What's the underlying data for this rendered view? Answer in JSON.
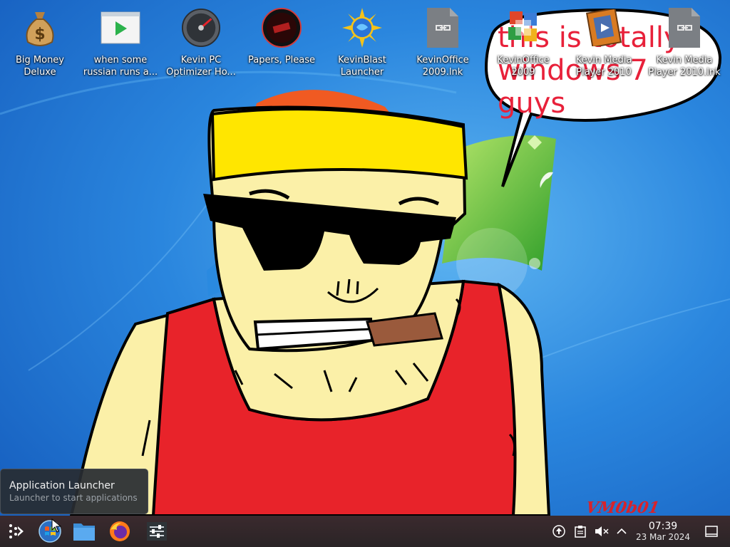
{
  "desktop_icons": [
    {
      "name": "big-money-deluxe",
      "icon": "money-bag-icon",
      "line1": "Big Money",
      "line2": "Deluxe"
    },
    {
      "name": "russian-video",
      "icon": "video-player-icon",
      "line1": "when some",
      "line2": "russian runs a..."
    },
    {
      "name": "kevin-pc-optimizer",
      "icon": "speedometer-icon",
      "line1": "Kevin PC",
      "line2": "Optimizer Ho..."
    },
    {
      "name": "papers-please",
      "icon": "papers-please-icon",
      "line1": "Papers, Please",
      "line2": ""
    },
    {
      "name": "kevinblast-launcher",
      "icon": "sun-globe-icon",
      "line1": "KevinBlast",
      "line2": "Launcher"
    },
    {
      "name": "kevinoffice-2009-lnk",
      "icon": "link-file-icon",
      "line1": "KevinOffice",
      "line2": "2009.lnk"
    },
    {
      "name": "kevinoffice-2009",
      "icon": "office-icon",
      "line1": "KevinOffice",
      "line2": "2009"
    },
    {
      "name": "kevin-media-player-2010",
      "icon": "media-film-icon",
      "line1": "Kevin Media",
      "line2": "Player 2010"
    },
    {
      "name": "kevin-media-player-2010-lnk",
      "icon": "link-file-icon",
      "line1": "Kevin Media",
      "line2": "Player 2010.lnk"
    }
  ],
  "wallpaper": {
    "speech_line1": "this is totally",
    "speech_line2": "windows 7 guys",
    "signature": "VM0b01",
    "colors": {
      "sky": "#1f78d6",
      "shirt": "#e8232a",
      "skin": "#fbf0a8",
      "headband": "#ffe600",
      "speech": "#e8213a"
    }
  },
  "tooltip": {
    "title": "Application Launcher",
    "subtitle": "Launcher to start applications"
  },
  "taskbar": {
    "launcher": "kde-launcher-icon",
    "pinned": [
      {
        "name": "windows-orb",
        "icon": "windows-orb-icon"
      },
      {
        "name": "file-manager",
        "icon": "folder-icon"
      },
      {
        "name": "firefox",
        "icon": "firefox-icon"
      },
      {
        "name": "settings",
        "icon": "sliders-icon"
      }
    ],
    "tray_icons": [
      "update-icon",
      "clipboard-icon",
      "volume-muted-icon",
      "chevron-up-icon"
    ],
    "clock": {
      "time": "07:39",
      "date": "23 Mar 2024"
    },
    "show_desktop": "show-desktop-icon"
  }
}
